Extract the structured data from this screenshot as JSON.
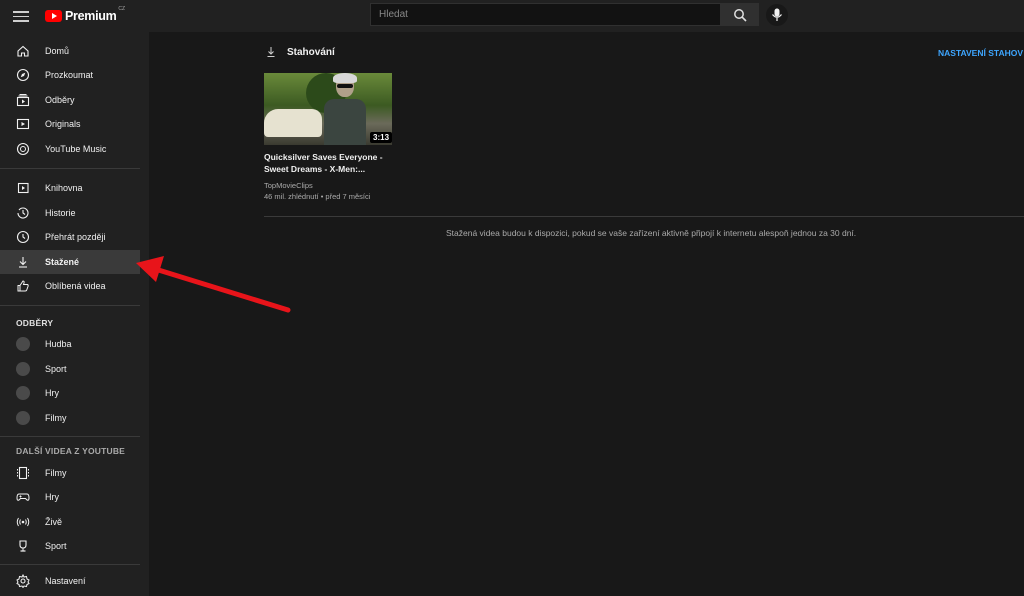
{
  "header": {
    "logo_text": "Premium",
    "logo_country": "CZ",
    "search_placeholder": "Hledat"
  },
  "sidebar": {
    "main": [
      {
        "label": "Domů",
        "icon": "home-icon"
      },
      {
        "label": "Prozkoumat",
        "icon": "compass-icon"
      },
      {
        "label": "Odběry",
        "icon": "subscriptions-icon"
      },
      {
        "label": "Originals",
        "icon": "originals-icon"
      },
      {
        "label": "YouTube Music",
        "icon": "music-icon"
      }
    ],
    "library": [
      {
        "label": "Knihovna",
        "icon": "library-icon"
      },
      {
        "label": "Historie",
        "icon": "history-icon"
      },
      {
        "label": "Přehrát později",
        "icon": "clock-icon"
      },
      {
        "label": "Stažené",
        "icon": "download-icon",
        "active": true
      },
      {
        "label": "Oblíbená videa",
        "icon": "thumbs-up-icon"
      }
    ],
    "subscriptions_title": "ODBĚRY",
    "subscriptions": [
      {
        "label": "Hudba",
        "icon": "music-channel-icon"
      },
      {
        "label": "Sport",
        "icon": "sport-channel-icon"
      },
      {
        "label": "Hry",
        "icon": "games-channel-icon"
      },
      {
        "label": "Filmy",
        "icon": "movies-channel-icon"
      }
    ],
    "more_title": "DALŠÍ VIDEA Z YOUTUBE",
    "more": [
      {
        "label": "Filmy",
        "icon": "film-icon"
      },
      {
        "label": "Hry",
        "icon": "gamepad-icon"
      },
      {
        "label": "Živě",
        "icon": "live-icon"
      },
      {
        "label": "Sport",
        "icon": "trophy-icon"
      }
    ],
    "settings": {
      "label": "Nastavení",
      "icon": "gear-icon"
    }
  },
  "main": {
    "title": "Stahování",
    "settings_link": "NASTAVENÍ STAHOV",
    "video": {
      "title": "Quicksilver Saves Everyone - Sweet Dreams - X-Men:...",
      "duration": "3:13",
      "channel": "TopMovieClips",
      "meta": "46 mil. zhlédnutí • před 7 měsíci"
    },
    "note": "Stažená videa budou k dispozici, pokud se vaše zařízení aktivně připojí k internetu alespoň jednou za 30 dní."
  },
  "colors": {
    "accent_link": "#3ea6ff",
    "annotation_arrow": "#e8141a",
    "logo_red": "#ff0000"
  }
}
